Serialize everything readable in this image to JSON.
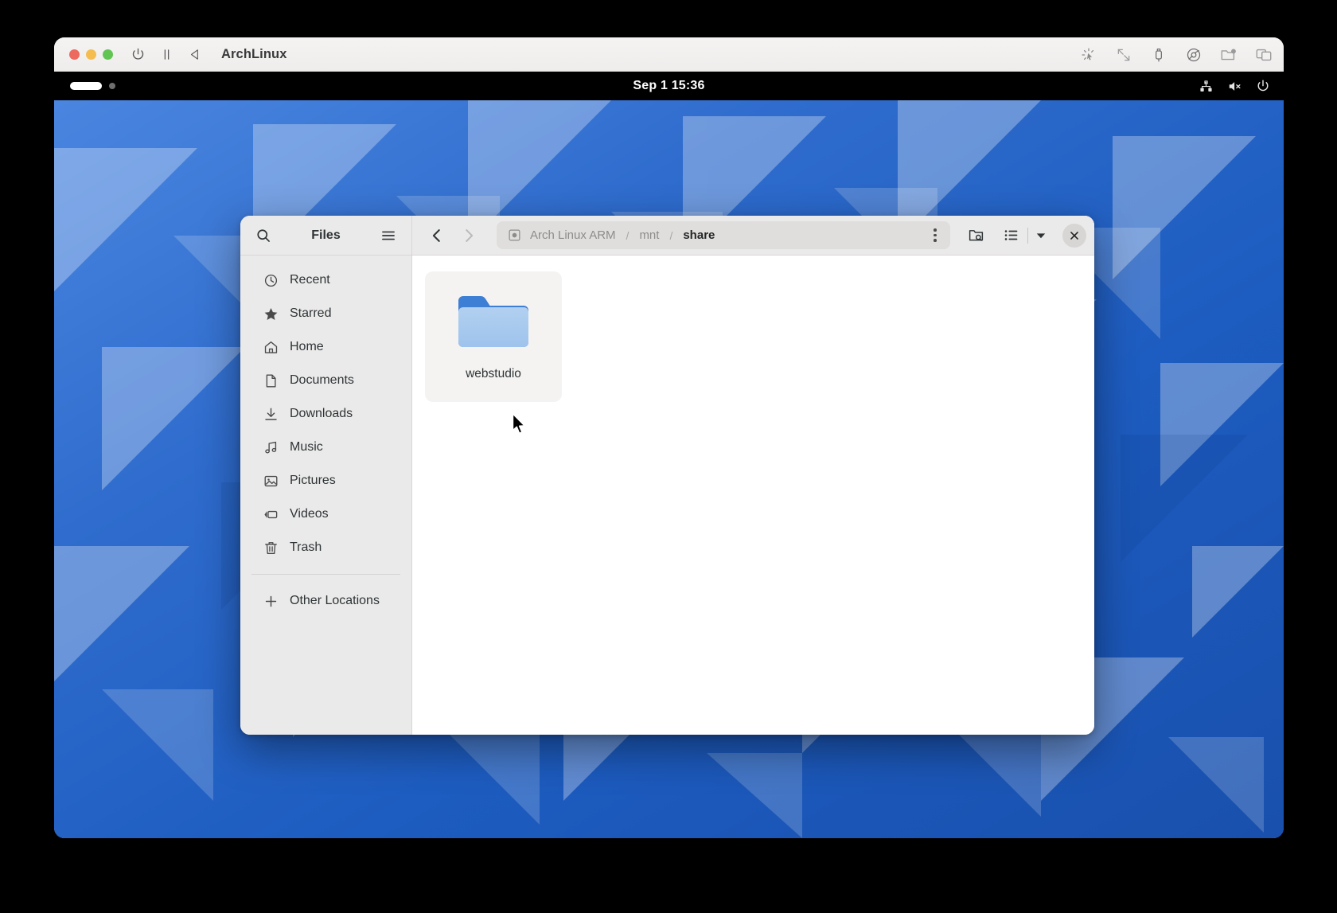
{
  "vm": {
    "title": "ArchLinux",
    "traffic_lights": [
      "close",
      "minimize",
      "maximize"
    ],
    "controls": [
      {
        "name": "power-icon",
        "label": "Power"
      },
      {
        "name": "pause-icon",
        "label": "Pause"
      },
      {
        "name": "play-back-icon",
        "label": "Resume"
      }
    ],
    "right_icons": [
      {
        "name": "brightness-cursor-icon",
        "label": "Pointer"
      },
      {
        "name": "resize-arrows-icon",
        "label": "Scale"
      },
      {
        "name": "usb-icon",
        "label": "USB"
      },
      {
        "name": "disc-icon",
        "label": "CD/DVD"
      },
      {
        "name": "shared-folder-icon",
        "label": "Shared Folders"
      },
      {
        "name": "windows-stack-icon",
        "label": "Windows"
      }
    ]
  },
  "gnome": {
    "activities_label": "Activities",
    "clock": "Sep 1  15:36",
    "status_icons": [
      {
        "name": "network-unknown-icon",
        "label": "Network"
      },
      {
        "name": "volume-muted-icon",
        "label": "Volume muted"
      },
      {
        "name": "power-menu-icon",
        "label": "Power menu"
      }
    ]
  },
  "files": {
    "title": "Files",
    "search_label": "Search",
    "menu_label": "Main Menu",
    "nav": {
      "back_label": "Back",
      "forward_label": "Forward"
    },
    "pathbar": {
      "root_icon": "drive-icon",
      "crumbs": [
        {
          "label": "Arch Linux ARM",
          "active": false
        },
        {
          "label": "mnt",
          "active": false
        },
        {
          "label": "share",
          "active": true
        }
      ],
      "separator": "/",
      "menu_label": "Path options"
    },
    "toolbar": {
      "search_folder_label": "Search in folder",
      "view_list_label": "List view",
      "view_dropdown_label": "View options",
      "close_label": "Close"
    },
    "sidebar": {
      "items": [
        {
          "label": "Recent",
          "icon": "clock-icon"
        },
        {
          "label": "Starred",
          "icon": "star-icon"
        },
        {
          "label": "Home",
          "icon": "home-icon"
        },
        {
          "label": "Documents",
          "icon": "document-icon"
        },
        {
          "label": "Downloads",
          "icon": "download-icon"
        },
        {
          "label": "Music",
          "icon": "music-icon"
        },
        {
          "label": "Pictures",
          "icon": "picture-icon"
        },
        {
          "label": "Videos",
          "icon": "video-icon"
        },
        {
          "label": "Trash",
          "icon": "trash-icon"
        }
      ],
      "other_locations": {
        "label": "Other Locations",
        "icon": "plus-icon"
      }
    },
    "content": {
      "files": [
        {
          "name": "webstudio",
          "type": "folder"
        }
      ]
    }
  },
  "colors": {
    "accent": "#3584e4",
    "folder_body": "#a5c8ee",
    "folder_tab": "#3e7fd6",
    "desktop_blue": "#2f6ccd",
    "topbar_black": "#000000",
    "sidebar_grey": "#ebeaea",
    "header_grey": "#ebeaea"
  }
}
